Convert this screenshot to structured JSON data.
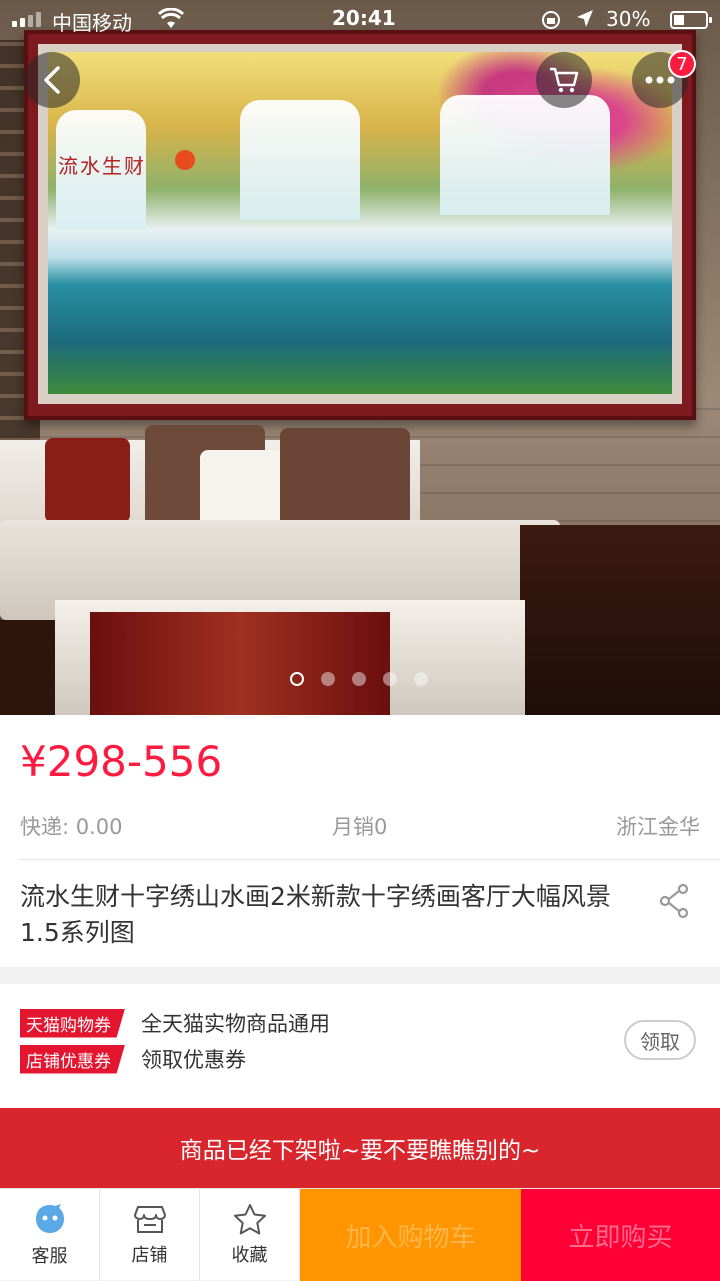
{
  "status_bar": {
    "carrier": "中国移动",
    "time": "20:41",
    "battery": "30%",
    "battery_level": 0.3
  },
  "header": {
    "back_icon": "chevron-left-icon",
    "cart_icon": "shopping-cart-icon",
    "more_icon": "more-dots-icon",
    "more_badge": "7"
  },
  "gallery": {
    "painting_title": "流水生财",
    "slide_count": 5,
    "active_slide": 1
  },
  "product": {
    "price": "¥298-556",
    "shipping": "快递: 0.00",
    "monthly_sales": "月销0",
    "location": "浙江金华",
    "title": "流水生财十字绣山水画2米新款十字绣画客厅大幅风景1.5系列图",
    "share_icon": "share-icon"
  },
  "coupons": {
    "items": [
      {
        "tag": "天猫购物券",
        "text": "全天猫实物商品通用"
      },
      {
        "tag": "店铺优惠券",
        "text": "领取优惠券"
      }
    ],
    "get_label": "领取"
  },
  "notice": {
    "text": "商品已经下架啦~要不要瞧瞧别的~"
  },
  "bottom_bar": {
    "service": {
      "label": "客服",
      "icon": "customer-service-icon"
    },
    "shop": {
      "label": "店铺",
      "icon": "store-icon"
    },
    "favorite": {
      "label": "收藏",
      "icon": "star-icon"
    },
    "add_to_cart": "加入购物车",
    "buy_now": "立即购买"
  },
  "colors": {
    "price": "#ff1a40",
    "banner": "#d9262c",
    "add_to_cart_bg": "#ff9500",
    "buy_now_bg": "#ff0036"
  }
}
